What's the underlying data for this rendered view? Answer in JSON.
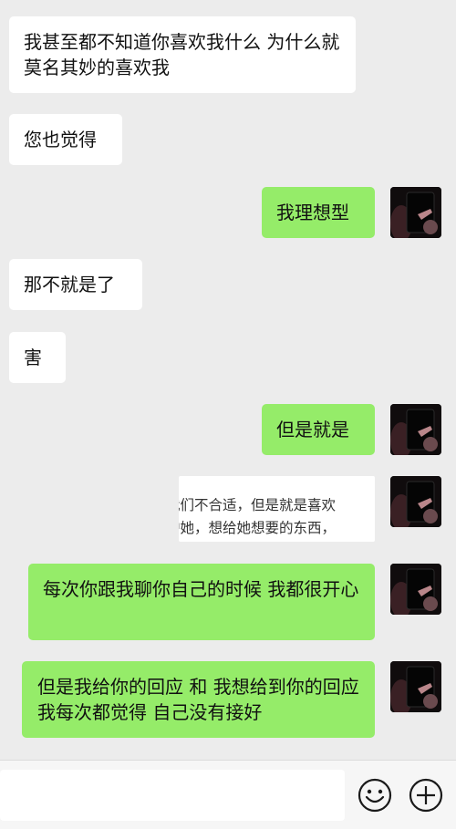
{
  "messages": [
    {
      "side": "left",
      "text": "我甚至都不知道你喜欢我什么 为什么就莫名其妙的喜欢我"
    },
    {
      "side": "left",
      "text": "您也觉得"
    },
    {
      "side": "right",
      "text": "我理想型"
    },
    {
      "side": "left",
      "text": "那不就是了"
    },
    {
      "side": "left",
      "text": "害"
    },
    {
      "side": "right",
      "text": "但是就是"
    },
    {
      "side": "right",
      "type": "image",
      "lines": [
        "我们不合适，但是就是喜欢",
        "护她，想给她想要的东西，"
      ]
    },
    {
      "side": "right",
      "text": "每次你跟我聊你自己的时候 我都很开心"
    },
    {
      "side": "right",
      "text": "但是我给你的回应 和 我想给到你的回应 我每次都觉得 自己没有接好"
    }
  ],
  "input": {
    "value": ""
  },
  "icons": {
    "emoji": "emoji-icon",
    "plus": "plus-icon"
  },
  "colors": {
    "background": "#ececec",
    "right_bubble": "#95ec69",
    "left_bubble": "#ffffff"
  }
}
